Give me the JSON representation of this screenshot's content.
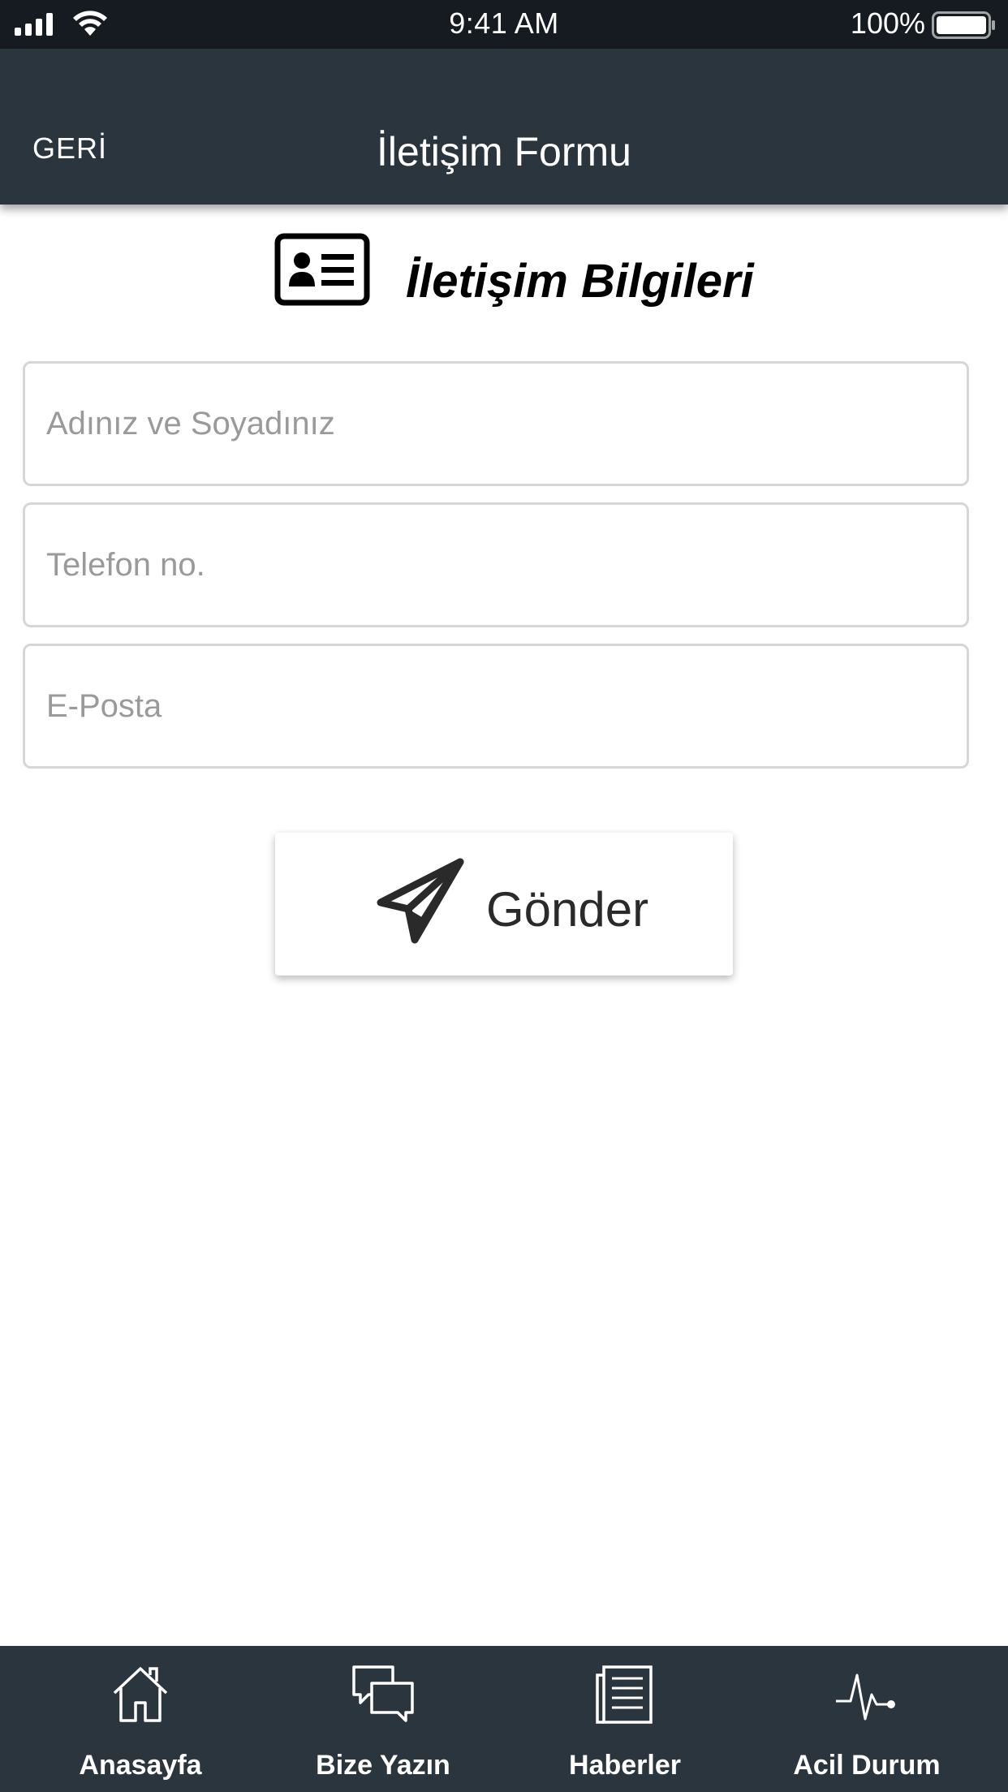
{
  "status_bar": {
    "time": "9:41 AM",
    "battery_percent": "100%"
  },
  "nav_bar": {
    "back_label": "GERİ",
    "title": "İletişim Formu"
  },
  "section": {
    "title": "İletişim Bilgileri",
    "icon": "id-card-icon"
  },
  "form": {
    "name_placeholder": "Adınız ve Soyadınız",
    "phone_placeholder": "Telefon no.",
    "email_placeholder": "E-Posta",
    "name_value": "",
    "phone_value": "",
    "email_value": ""
  },
  "submit": {
    "label": "Gönder",
    "icon": "paper-plane-icon"
  },
  "tab_bar": {
    "items": [
      {
        "label": "Anasayfa",
        "icon": "home-icon"
      },
      {
        "label": "Bize Yazın",
        "icon": "chat-bubbles-icon"
      },
      {
        "label": "Haberler",
        "icon": "newspaper-icon"
      },
      {
        "label": "Acil Durum",
        "icon": "heartbeat-icon"
      }
    ]
  },
  "colors": {
    "status_bar_bg": "#151b20",
    "nav_bg": "#2a353d",
    "tab_bar_bg": "#2a353d",
    "input_border": "#d6d6d6",
    "placeholder": "#9a9a9a"
  }
}
